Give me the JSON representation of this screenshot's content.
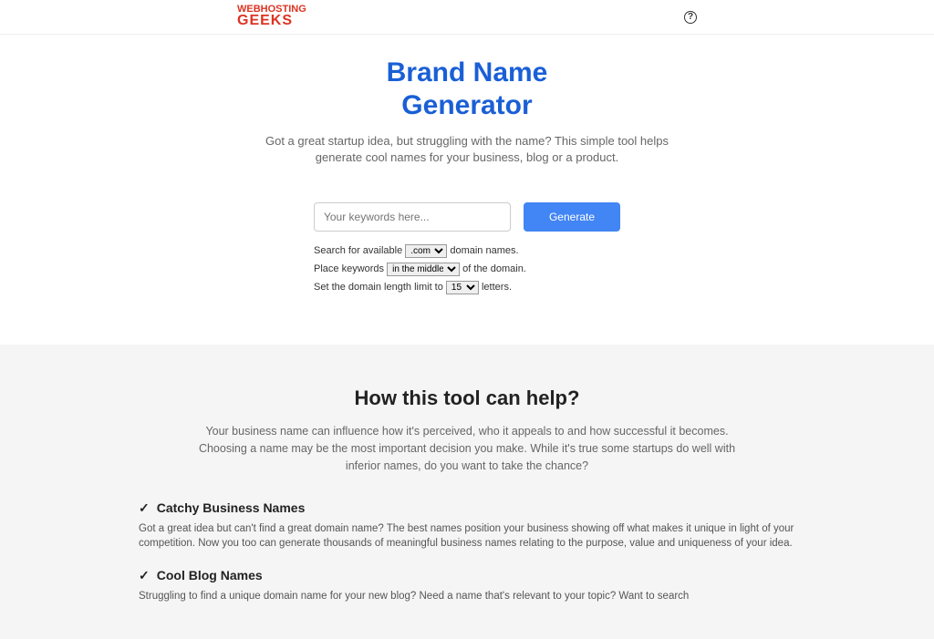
{
  "header": {
    "logo_line1": "WEBHOSTING",
    "logo_line2": "GEEKS",
    "help": "?"
  },
  "hero": {
    "title_line1": "Brand Name",
    "title_line2": "Generator",
    "subtitle": "Got a great startup idea, but struggling with the name? This simple tool helps generate cool names for your business, blog or a product."
  },
  "form": {
    "keyword_placeholder": "Your keywords here...",
    "generate_label": "Generate"
  },
  "options": {
    "line1_pre": "Search for available ",
    "tld_selected": ".com",
    "line1_post": " domain names.",
    "line2_pre": "Place keywords ",
    "placement_selected": "in the middle",
    "line2_post": " of the domain.",
    "line3_pre": "Set the domain length limit to ",
    "length_selected": "15",
    "line3_post": " letters."
  },
  "how": {
    "title": "How this tool can help?",
    "desc": "Your business name can influence how it's perceived, who it appeals to and how successful it becomes. Choosing a name may be the most important decision you make. While it's true some startups do well with inferior names, do you want to take the chance?",
    "features": [
      {
        "title": "Catchy Business Names",
        "body": "Got a great idea but can't find a great domain name? The best names position your business showing off what makes it unique in light of your competition. Now you too can generate thousands of meaningful business names relating to the purpose, value and uniqueness of your idea."
      },
      {
        "title": "Cool Blog Names",
        "body": "Struggling to find a unique domain name for your new blog? Need a name that's relevant to your topic? Want to search"
      }
    ]
  }
}
